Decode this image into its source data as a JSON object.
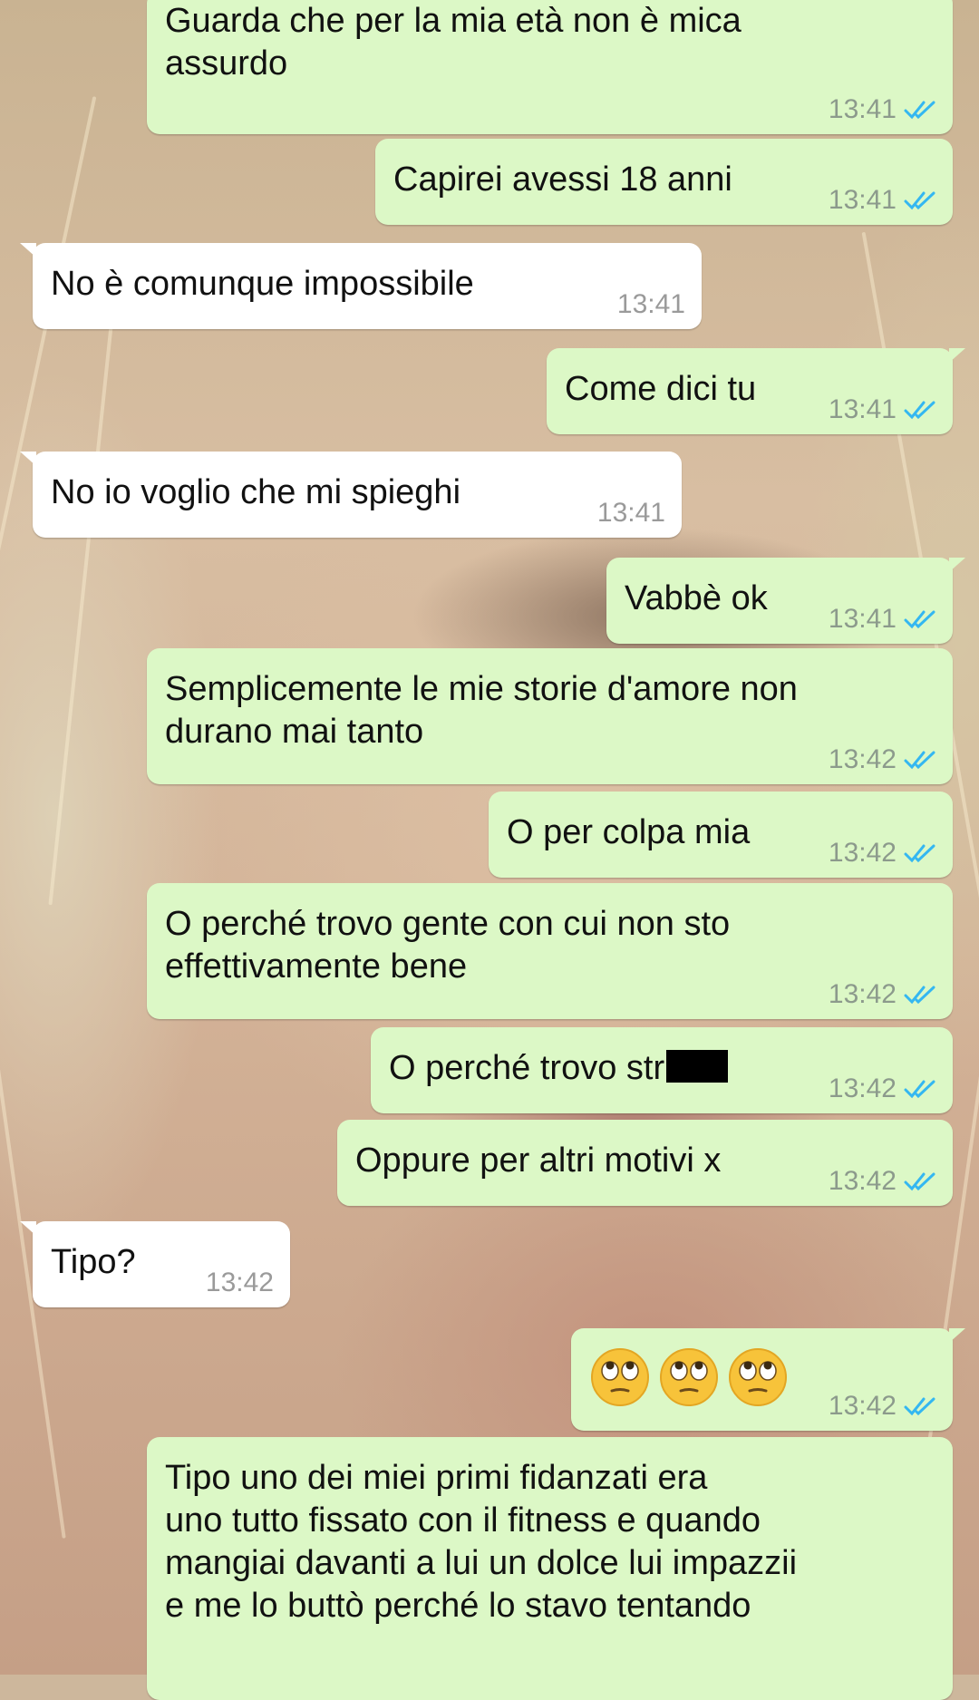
{
  "messages": [
    {
      "dir": "out",
      "lines": [
        "Guarda che per la mia età non è mica",
        "assurdo"
      ],
      "time": "13:41"
    },
    {
      "dir": "out",
      "lines": [
        "Capirei avessi 18 anni"
      ],
      "time": "13:41"
    },
    {
      "dir": "in",
      "lines": [
        "No è comunque impossibile"
      ],
      "time": "13:41"
    },
    {
      "dir": "out",
      "lines": [
        "Come dici tu"
      ],
      "time": "13:41"
    },
    {
      "dir": "in",
      "lines": [
        "No io voglio che mi spieghi"
      ],
      "time": "13:41"
    },
    {
      "dir": "out",
      "lines": [
        "Vabbè ok"
      ],
      "time": "13:41"
    },
    {
      "dir": "out",
      "lines": [
        "Semplicemente le mie storie d'amore non",
        "durano mai tanto"
      ],
      "time": "13:42"
    },
    {
      "dir": "out",
      "lines": [
        "O per colpa mia"
      ],
      "time": "13:42"
    },
    {
      "dir": "out",
      "lines": [
        "O perché trovo gente con cui non sto",
        "effettivamente bene"
      ],
      "time": "13:42"
    },
    {
      "dir": "out",
      "lines": [
        "O perché trovo str"
      ],
      "time": "13:42",
      "redacted": true
    },
    {
      "dir": "out",
      "lines": [
        "Oppure per altri motivi x"
      ],
      "time": "13:42"
    },
    {
      "dir": "in",
      "lines": [
        "Tipo?"
      ],
      "time": "13:42"
    },
    {
      "dir": "out",
      "emoji": [
        "face-with-rolling-eyes-icon",
        "face-with-rolling-eyes-icon",
        "face-with-rolling-eyes-icon"
      ],
      "time": "13:42"
    },
    {
      "dir": "out",
      "lines": [
        "Tipo uno dei miei primi fidanzati era",
        "uno tutto fissato con il fitness e quando",
        "mangiai davanti a lui un dolce lui impazzii",
        "e me lo buttò perché lo stavo tentando"
      ],
      "time": ""
    }
  ],
  "colors": {
    "outgoing": "#dcf8c6",
    "incoming": "#ffffff",
    "read_ticks": "#34b7f1"
  }
}
